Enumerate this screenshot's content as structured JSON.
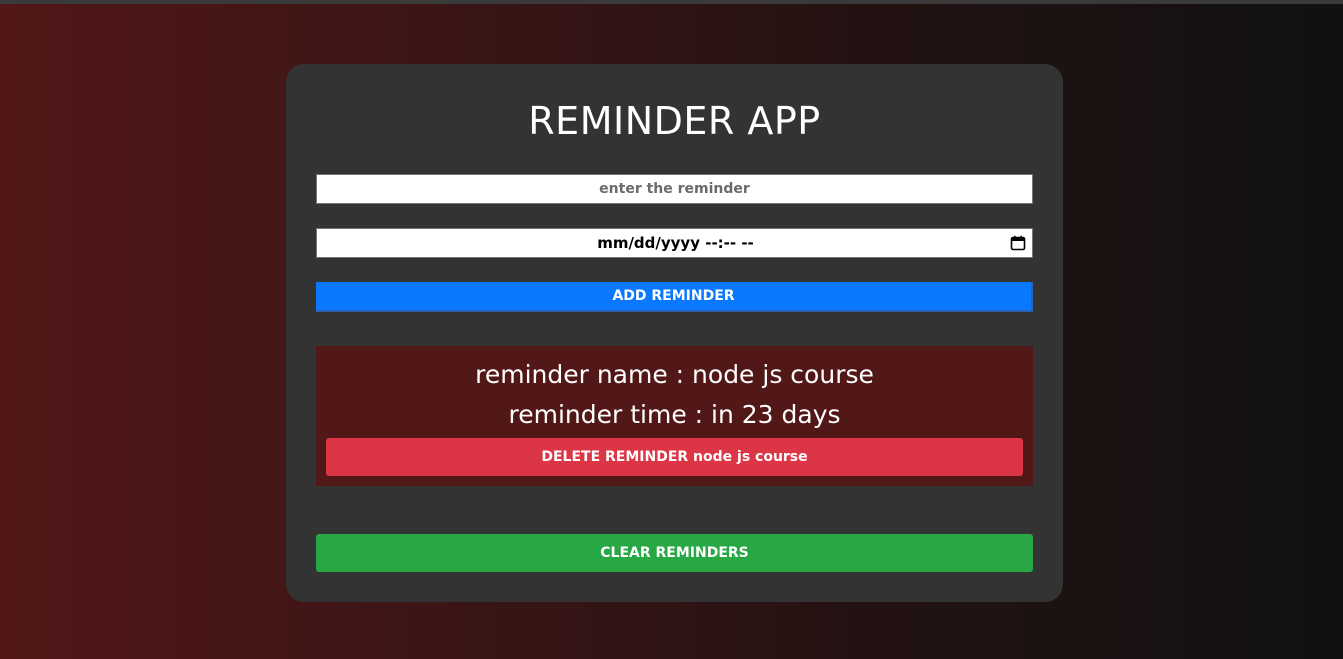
{
  "app": {
    "title": "REMINDER APP"
  },
  "form": {
    "reminder_placeholder": "enter the reminder",
    "reminder_value": "",
    "datetime_placeholder": "mm/dd/yyyy --:-- --",
    "add_label": "ADD REMINDER"
  },
  "reminders": [
    {
      "name_text": "reminder name : node js course",
      "time_text": "reminder time : in 23 days",
      "delete_label": "DELETE REMINDER node js course"
    }
  ],
  "actions": {
    "clear_label": "CLEAR REMINDERS"
  },
  "icons": {
    "calendar": "calendar-icon"
  },
  "colors": {
    "add_button": "#0a78ff",
    "delete_button": "#dc3545",
    "clear_button": "#28a745",
    "reminder_card": "#521717",
    "panel": "#333333"
  }
}
